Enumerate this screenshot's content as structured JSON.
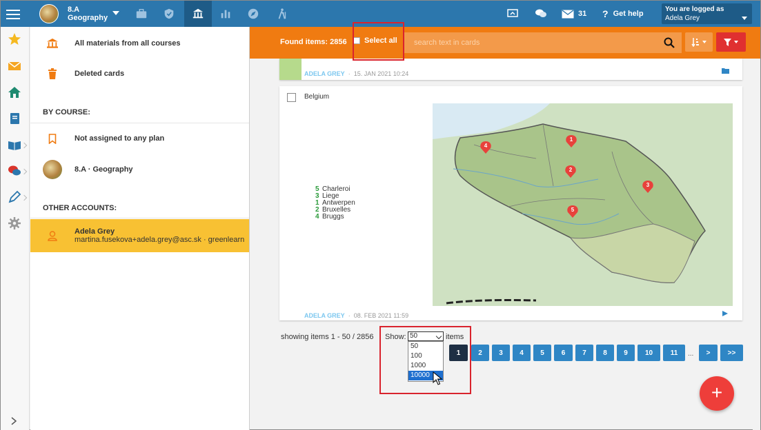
{
  "header": {
    "course_line1": "8.A",
    "course_line2": "Geography",
    "messages_count": "31",
    "help_label": "Get help",
    "logged_as_label": "You are logged as",
    "user_name": "Adela Grey"
  },
  "sidebar": {
    "all_materials": "All materials from all courses",
    "deleted_cards": "Deleted cards",
    "by_course_heading": "BY COURSE:",
    "not_assigned": "Not assigned to any plan",
    "course_item": "8.A · Geography",
    "other_accounts_heading": "OTHER ACCOUNTS:",
    "account_name": "Adela Grey",
    "account_detail": "martina.fusekova+adela.grey@asc.sk · greenlearn"
  },
  "toolbar": {
    "found_items": "Found items: 2856",
    "select_all": "Select all",
    "search_placeholder": "search text in cards"
  },
  "cards": {
    "card1": {
      "author": "ADELA GREY",
      "date": "15. JAN 2021 10:24"
    },
    "card2": {
      "title": "Belgium",
      "author": "ADELA GREY",
      "date": "08. FEB 2021 11:59",
      "legend": [
        {
          "num": "5",
          "city": "Charleroi"
        },
        {
          "num": "3",
          "city": "Liege"
        },
        {
          "num": "1",
          "city": "Antwerpen"
        },
        {
          "num": "2",
          "city": "Bruxelles"
        },
        {
          "num": "4",
          "city": "Bruggs"
        }
      ],
      "markers": [
        "1",
        "2",
        "3",
        "4",
        "5"
      ]
    }
  },
  "pagination": {
    "showing": "showing items 1 - 50 / 2856",
    "show_label": "Show:",
    "items_label": "items",
    "selected": "50",
    "options": [
      "50",
      "100",
      "1000",
      "10000"
    ],
    "pages": [
      "1",
      "2",
      "3",
      "4",
      "5",
      "6",
      "7",
      "8",
      "9",
      "10",
      "11"
    ],
    "ellipsis": "...",
    "next": ">",
    "last": ">>"
  },
  "fab_label": "+",
  "colors": {
    "topbar": "#2c77ad",
    "orange": "#f07b11",
    "account_highlight": "#f8c133",
    "page_button": "#2f86c5",
    "fab": "#ee3e3a"
  }
}
